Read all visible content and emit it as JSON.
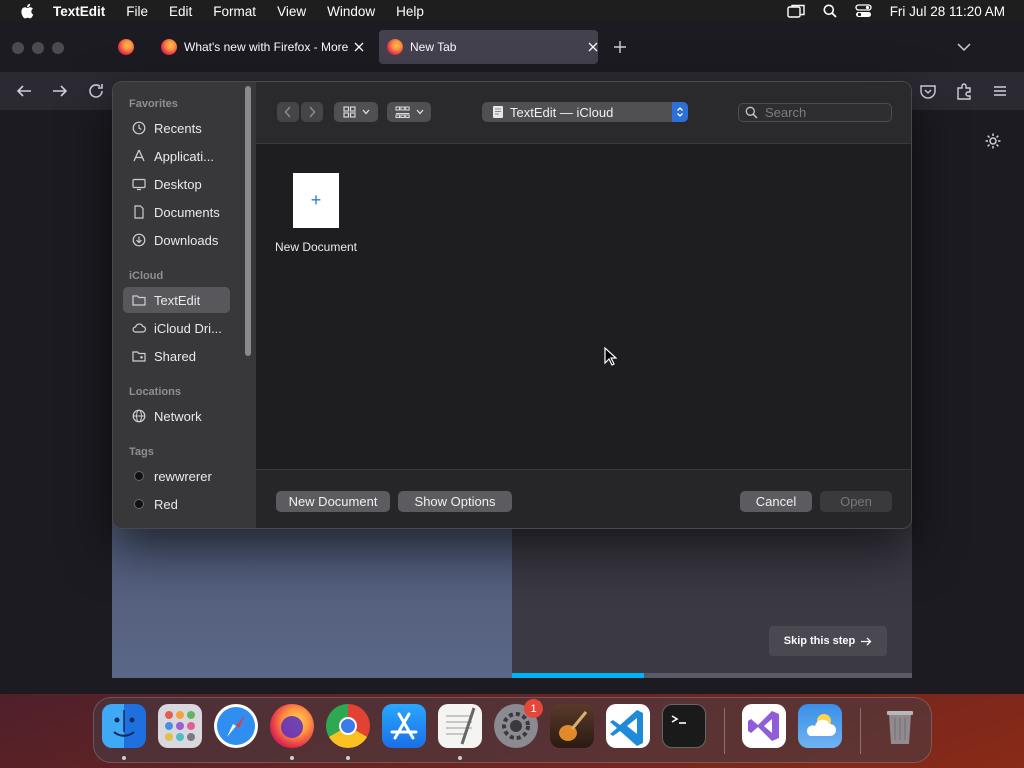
{
  "menubar": {
    "app_name": "TextEdit",
    "items": [
      "File",
      "Edit",
      "Format",
      "View",
      "Window",
      "Help"
    ],
    "clock": "Fri Jul 28  11:20 AM"
  },
  "browser": {
    "tabs": [
      {
        "title": "What's new with Firefox - More"
      },
      {
        "title": "New Tab"
      }
    ],
    "skip_label": "Skip this step",
    "progress": 0.33
  },
  "dialog": {
    "sidebar": {
      "sections": {
        "favorites": "Favorites",
        "icloud": "iCloud",
        "locations": "Locations",
        "tags": "Tags"
      },
      "favorites": [
        "Recents",
        "Applicati...",
        "Desktop",
        "Documents",
        "Downloads"
      ],
      "icloud": [
        "TextEdit",
        "iCloud Dri...",
        "Shared"
      ],
      "locations": [
        "Network"
      ],
      "tags": [
        "rewwrerer",
        "Red"
      ]
    },
    "location": "TextEdit — iCloud",
    "search_placeholder": "Search",
    "file_tile_label": "New Document",
    "buttons": {
      "new_document": "New Document",
      "show_options": "Show Options",
      "cancel": "Cancel",
      "open": "Open"
    }
  },
  "dock": {
    "apps": [
      "Finder",
      "Launchpad",
      "Safari",
      "Firefox",
      "Chrome",
      "App Store",
      "TextEdit",
      "System Settings",
      "GarageBand",
      "Visual Studio Code",
      "Terminal",
      "Visual Studio",
      "Weather",
      "Trash"
    ],
    "settings_badge": "1"
  }
}
